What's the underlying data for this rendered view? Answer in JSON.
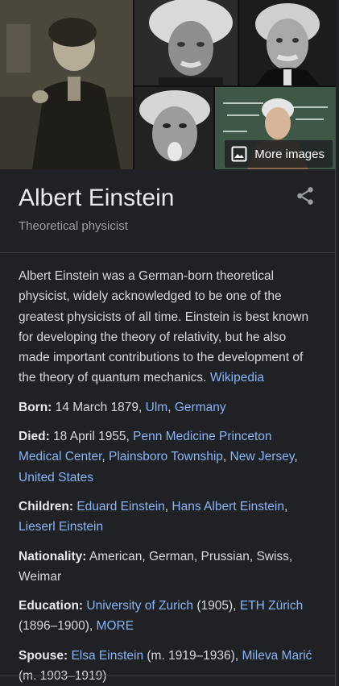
{
  "gallery": {
    "more_images_label": "More images",
    "images": [
      {
        "name": "portrait-lecture"
      },
      {
        "name": "portrait-windswept-hair"
      },
      {
        "name": "portrait-suit"
      },
      {
        "name": "portrait-tongue"
      },
      {
        "name": "portrait-chalkboard"
      }
    ]
  },
  "entity": {
    "title": "Albert Einstein",
    "subtitle": "Theoretical physicist"
  },
  "description": {
    "text": "Albert Einstein was a German-born theoretical physicist, widely acknowledged to be one of the greatest physicists of all time. Einstein is best known for developing the theory of relativity, but he also made important contributions to the development of the theory of quantum mechanics.",
    "source_link": "Wikipedia"
  },
  "facts": {
    "born": {
      "label": "Born:",
      "date": "14 March 1879,",
      "place1": "Ulm",
      "sep": ",",
      "place2": "Germany"
    },
    "died": {
      "label": "Died:",
      "date": "18 April 1955,",
      "place1": "Penn Medicine Princeton Medical Center",
      "sep1": ",",
      "place2": "Plainsboro Township",
      "sep2": ",",
      "place3": "New Jersey",
      "sep3": ",",
      "place4": "United States"
    },
    "children": {
      "label": "Children:",
      "child1": "Eduard Einstein",
      "sep1": ",",
      "child2": "Hans Albert Einstein",
      "sep2": ",",
      "child3": "Lieserl Einstein"
    },
    "nationality": {
      "label": "Nationality:",
      "value": "American, German, Prussian, Swiss, Weimar"
    },
    "education": {
      "label": "Education:",
      "school1": "University of Zurich",
      "years1": "(1905),",
      "school2": "ETH Zürich",
      "years2": "(1896–1900),",
      "more": "MORE"
    },
    "spouse": {
      "label": "Spouse:",
      "spouse1": "Elsa Einstein",
      "years1": "(m. 1919–1936),",
      "spouse2": "Mileva Marić",
      "years2": "(m. 1903–1919)"
    }
  },
  "colors": {
    "background": "#202124",
    "link": "#8ab4f8",
    "text": "#e8eaed",
    "muted": "#9aa0a6"
  }
}
